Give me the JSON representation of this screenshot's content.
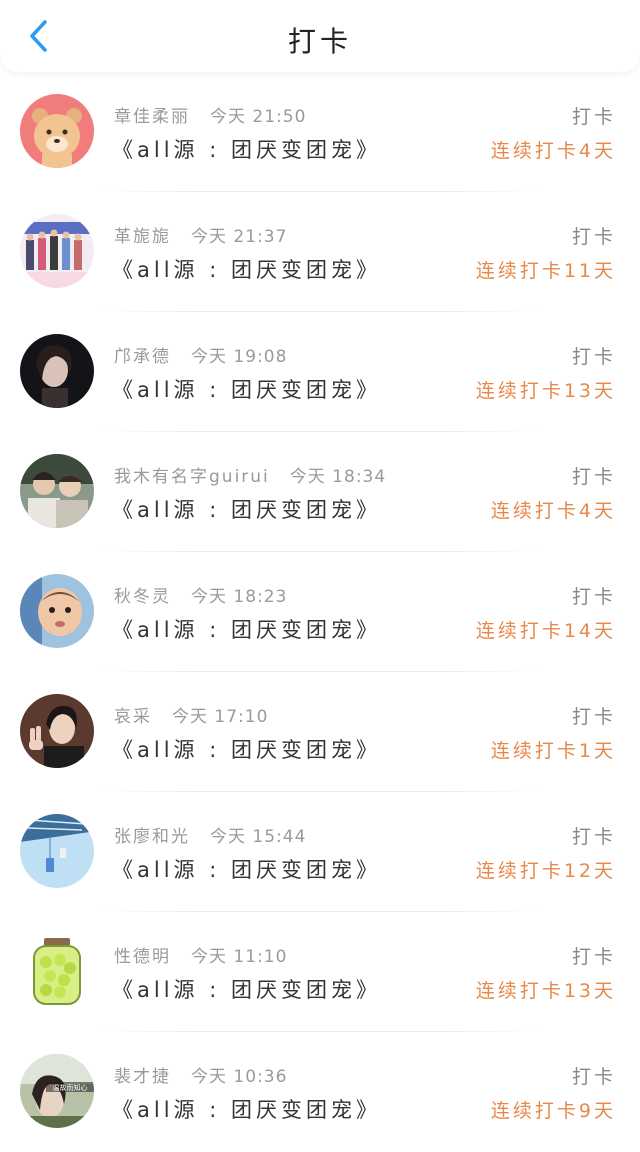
{
  "header": {
    "title": "打卡",
    "back_icon": "chevron-left-icon",
    "accent": "#2b9cf2"
  },
  "colors": {
    "streak": "#e8894a",
    "meta": "#9a9a9a"
  },
  "items": [
    {
      "name": "章佳柔丽",
      "time": "今天 21:50",
      "book": "《all源 : 团厌变团宠》",
      "checkin": "打卡",
      "streak": "连续打卡4天",
      "avatar": "cartoon-bear-avatar"
    },
    {
      "name": "革旎旎",
      "time": "今天 21:37",
      "book": "《all源 : 团厌变团宠》",
      "checkin": "打卡",
      "streak": "连续打卡11天",
      "avatar": "group-photo-avatar"
    },
    {
      "name": "邝承德",
      "time": "今天 19:08",
      "book": "《all源 : 团厌变团宠》",
      "checkin": "打卡",
      "streak": "连续打卡13天",
      "avatar": "dark-portrait-avatar"
    },
    {
      "name": "我木有名字guirui",
      "time": "今天 18:34",
      "book": "《all源 : 团厌变团宠》",
      "checkin": "打卡",
      "streak": "连续打卡4天",
      "avatar": "two-people-avatar"
    },
    {
      "name": "秋冬灵",
      "time": "今天 18:23",
      "book": "《all源 : 团厌变团宠》",
      "checkin": "打卡",
      "streak": "连续打卡14天",
      "avatar": "baby-photo-avatar"
    },
    {
      "name": "哀采",
      "time": "今天 17:10",
      "book": "《all源 : 团厌变团宠》",
      "checkin": "打卡",
      "streak": "连续打卡1天",
      "avatar": "boy-peace-sign-avatar"
    },
    {
      "name": "张廖和光",
      "time": "今天 15:44",
      "book": "《all源 : 团厌变团宠》",
      "checkin": "打卡",
      "streak": "连续打卡12天",
      "avatar": "wind-chime-sky-avatar"
    },
    {
      "name": "性德明",
      "time": "今天 11:10",
      "book": "《all源 : 团厌变团宠》",
      "checkin": "打卡",
      "streak": "连续打卡13天",
      "avatar": "lemon-jar-avatar"
    },
    {
      "name": "裴才捷",
      "time": "今天 10:36",
      "book": "《all源 : 团厌变团宠》",
      "checkin": "打卡",
      "streak": "连续打卡9天",
      "avatar": "girl-outdoor-avatar",
      "avatar_caption": "温故而知心"
    }
  ]
}
